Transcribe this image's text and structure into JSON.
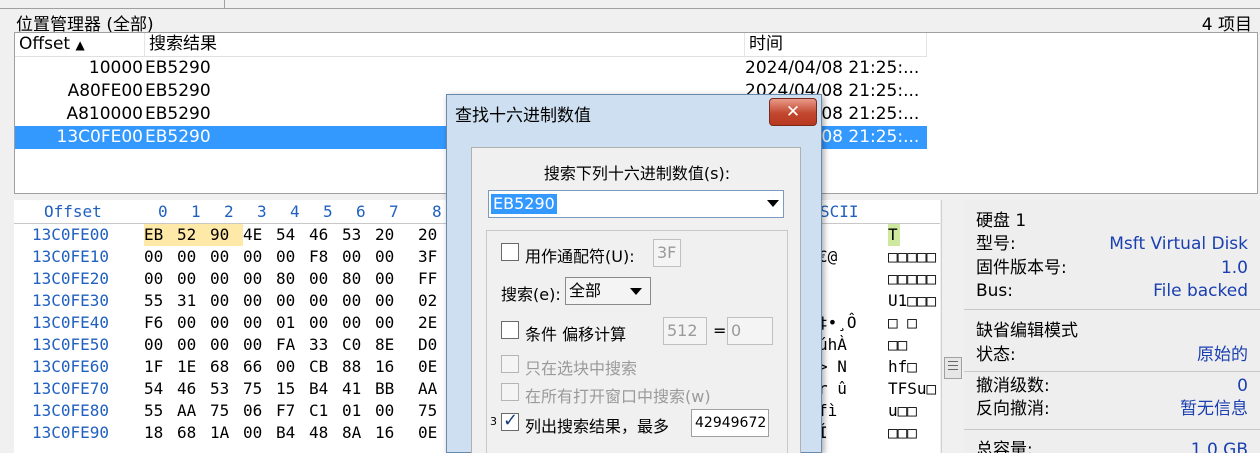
{
  "position_manager": {
    "title": "位置管理器 (全部)",
    "count": "4 项目",
    "columns": [
      "Offset",
      "搜索结果",
      "时间"
    ],
    "sort_indicator": "▲",
    "rows": [
      {
        "offset": "10000",
        "result": "EB5290",
        "time": "2024/04/08  21:25:..."
      },
      {
        "offset": "A80FE00",
        "result": "EB5290",
        "time": "2024/04/08  21:25:..."
      },
      {
        "offset": "A810000",
        "result": "EB5290",
        "time": "2024/04/08  21:25:..."
      },
      {
        "offset": "13C0FE00",
        "result": "EB5290",
        "time": "2024/04/08  21:25:..."
      }
    ]
  },
  "hex_view": {
    "offset_label": "Offset",
    "column_labels": [
      "0",
      "1",
      "2",
      "3",
      "4",
      "5",
      "6",
      "7",
      "8"
    ],
    "ascii_label": "SCII",
    "rows": [
      {
        "offset": "13C0FE00",
        "bytes": [
          "EB",
          "52",
          "90",
          "4E",
          "54",
          "46",
          "53",
          "20",
          "20"
        ],
        "ascii": "",
        "ascii2": "T"
      },
      {
        "offset": "13C0FE10",
        "bytes": [
          "00",
          "00",
          "00",
          "00",
          "00",
          "F8",
          "00",
          "00",
          "3F"
        ],
        "ascii": "€@",
        "ascii2": "□□□□□"
      },
      {
        "offset": "13C0FE20",
        "bytes": [
          "00",
          "00",
          "00",
          "00",
          "80",
          "00",
          "80",
          "00",
          "FF"
        ],
        "ascii": "",
        "ascii2": "□□□□□"
      },
      {
        "offset": "13C0FE30",
        "bytes": [
          "55",
          "31",
          "00",
          "00",
          "00",
          "00",
          "00",
          "00",
          "02"
        ],
        "ascii": "",
        "ascii2": "U1□□□"
      },
      {
        "offset": "13C0FE40",
        "bytes": [
          "F6",
          "00",
          "00",
          "00",
          "01",
          "00",
          "00",
          "00",
          "2E"
        ],
        "ascii": "‡•¸Ô",
        "ascii2": "□    □"
      },
      {
        "offset": "13C0FE50",
        "bytes": [
          "00",
          "00",
          "00",
          "00",
          "FA",
          "33",
          "C0",
          "8E",
          "D0"
        ],
        "ascii": "úhÀ",
        "ascii2": "□□"
      },
      {
        "offset": "13C0FE60",
        "bytes": [
          "1F",
          "1E",
          "68",
          "66",
          "00",
          "CB",
          "88",
          "16",
          "0E"
        ],
        "ascii": ">  N",
        "ascii2": "hf□"
      },
      {
        "offset": "13C0FE70",
        "bytes": [
          "54",
          "46",
          "53",
          "75",
          "15",
          "B4",
          "41",
          "BB",
          "AA"
        ],
        "ascii": "r  û",
        "ascii2": "TFSu□"
      },
      {
        "offset": "13C0FE80",
        "bytes": [
          "55",
          "AA",
          "75",
          "06",
          "F7",
          "C1",
          "01",
          "00",
          "75"
        ],
        "ascii": "  fì",
        "ascii2": "u□□"
      },
      {
        "offset": "13C0FE90",
        "bytes": [
          "18",
          "68",
          "1A",
          "00",
          "B4",
          "48",
          "8A",
          "16",
          "0E"
        ],
        "ascii": "  Í",
        "ascii2": "□□□"
      }
    ]
  },
  "info_panel": {
    "disk_title": "硬盘 1",
    "model_label": "型号:",
    "model_value": "Msft Virtual Disk",
    "firmware_label": "固件版本号:",
    "firmware_value": "1.0",
    "bus_label": "Bus:",
    "bus_value": "File backed",
    "mode_title": "缺省编辑模式",
    "state_label": "状态:",
    "state_value": "原始的",
    "undo_label": "撤消级数:",
    "undo_value": "0",
    "redo_label": "反向撤消:",
    "redo_value": "暂无信息",
    "capacity_label": "总容量:",
    "capacity_value": "1.0 GB"
  },
  "dialog": {
    "title": "查找十六进制数值",
    "close_glyph": "✕",
    "prompt": "搜索下列十六进制数值(s):",
    "search_value": "EB5290",
    "wildcard_label": "用作通配符(U):",
    "wildcard_value": "3F",
    "search_label": "搜索(e):",
    "search_scope": "全部",
    "condition_label": "条件 偏移计算",
    "cond_mod": "512",
    "cond_eq": "=",
    "cond_rem": "0",
    "in_block_label": "只在选块中搜索",
    "all_windows_label": "在所有打开窗口中搜索(w)",
    "list_prefix": "3",
    "list_label": "列出搜索结果，最多",
    "list_max": "42949672",
    "colors": {
      "title_bar": "#cddff0",
      "close": "#c2472e",
      "selection": "#3399ff"
    }
  }
}
